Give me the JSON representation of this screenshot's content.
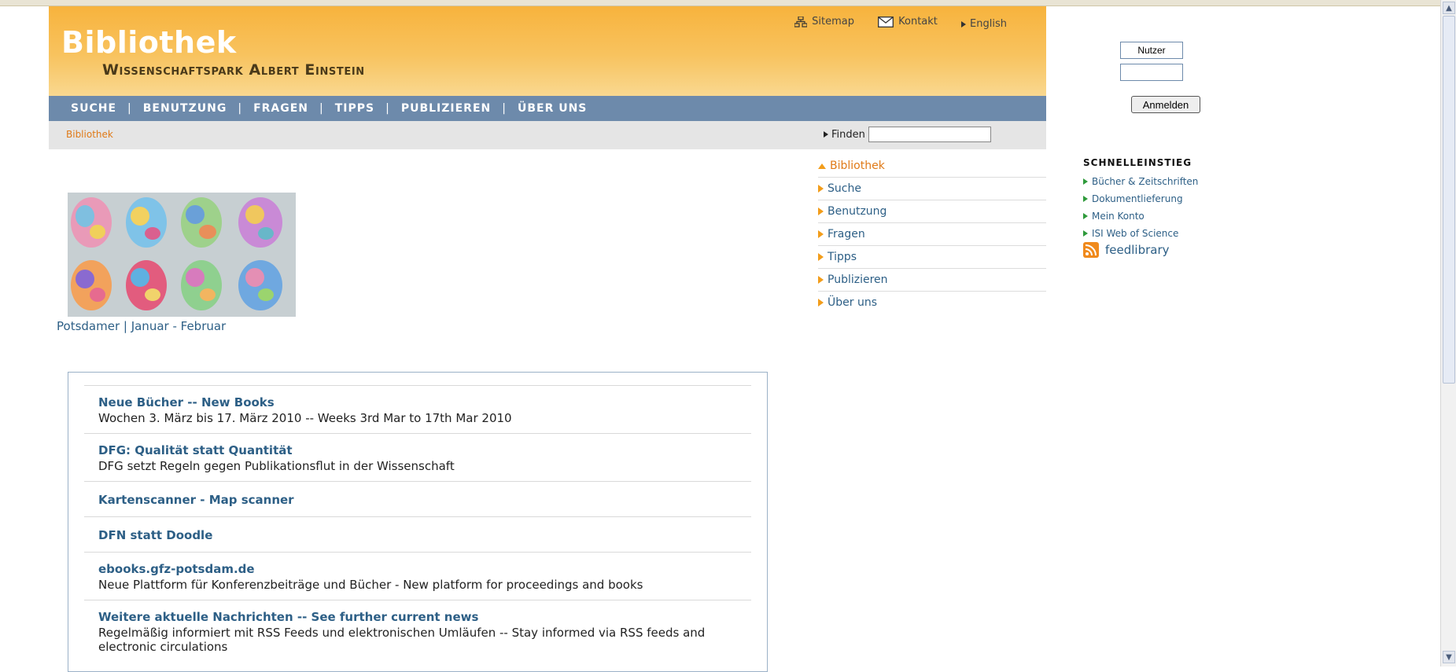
{
  "header": {
    "title": "Bibliothek",
    "subtitle": "Wissenschaftspark Albert Einstein",
    "links": {
      "sitemap": "Sitemap",
      "kontakt": "Kontakt",
      "english": "English"
    }
  },
  "mainnav": [
    "SUCHE",
    "BENUTZUNG",
    "FRAGEN",
    "TIPPS",
    "PUBLIZIEREN",
    "ÜBER UNS"
  ],
  "breadcrumb": "Bibliothek",
  "search": {
    "label": "Finden",
    "value": ""
  },
  "caption": "Potsdamer | Januar - Februar",
  "news": [
    {
      "title": "Neue Bücher -- New Books",
      "desc": "Wochen 3. März bis 17. März 2010 -- Weeks 3rd Mar to 17th Mar 2010"
    },
    {
      "title": "DFG: Qualität statt Quantität",
      "desc": "DFG setzt Regeln gegen Publikationsflut in der Wissenschaft"
    },
    {
      "title": "Kartenscanner - Map scanner",
      "desc": ""
    },
    {
      "title": "DFN statt Doodle",
      "desc": ""
    },
    {
      "title": "ebooks.gfz-potsdam.de",
      "desc": "Neue Plattform für Konferenzbeiträge und Bücher - New platform for proceedings and books"
    },
    {
      "title": "Weitere aktuelle Nachrichten -- See further current news",
      "desc": "Regelmäßig informiert mit RSS Feeds und elektronischen Umläufen -- Stay informed via RSS feeds and electronic circulations"
    }
  ],
  "subnav": [
    "Bibliothek",
    "Suche",
    "Benutzung",
    "Fragen",
    "Tipps",
    "Publizieren",
    "Über uns"
  ],
  "login": {
    "user_value": "Nutzer",
    "password_value": "",
    "button": "Anmelden"
  },
  "quick": {
    "heading": "SCHNELLEINSTIEG",
    "items": [
      "Bücher & Zeitschriften",
      "Dokumentlieferung",
      "Mein Konto",
      "ISI Web of Science"
    ],
    "feed": "feedlibrary"
  },
  "colors": {
    "header_orange": "#f7b33d",
    "nav_blue": "#6d8aab",
    "link_blue": "#2d5f86",
    "accent_orange": "#e07a18"
  }
}
